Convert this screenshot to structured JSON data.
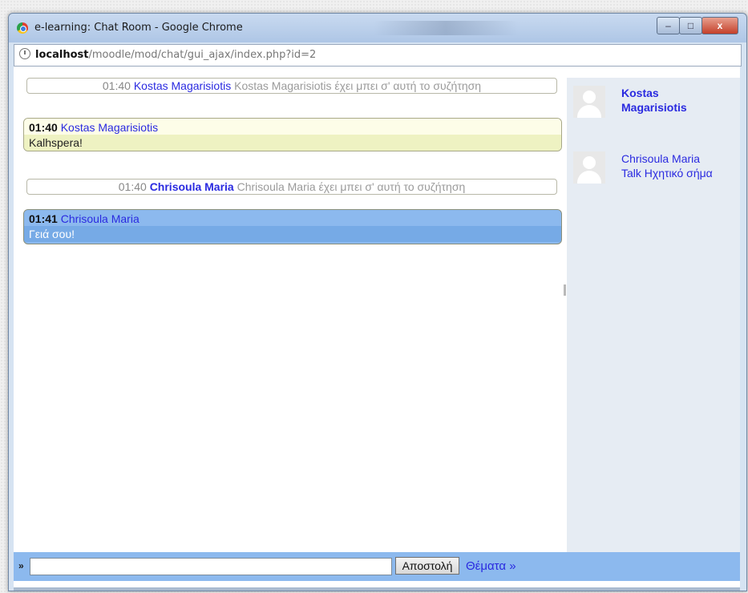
{
  "window": {
    "title": "e-learning: Chat Room - Google Chrome",
    "controls": {
      "minimize": "–",
      "maximize": "□",
      "close": "x"
    }
  },
  "urlbar": {
    "host": "localhost",
    "path": "/moodle/mod/chat/gui_ajax/index.php?id=2"
  },
  "messages": [
    {
      "kind": "system",
      "time": "01:40",
      "user": "Kostas Magarisiotis",
      "text": "Kostas Magarisiotis έχει μπει σ' αυτή το συζήτηση"
    },
    {
      "kind": "chat",
      "time": "01:40",
      "user": "Kostas Magarisiotis",
      "text": "Kalhspera!"
    },
    {
      "kind": "system",
      "time": "01:40",
      "user": "Chrisoula Maria",
      "text": "Chrisoula Maria έχει μπει σ' αυτή το συζήτηση"
    },
    {
      "kind": "chat",
      "time": "01:41",
      "user": "Chrisoula Maria",
      "text": "Γειά σου!"
    }
  ],
  "users": [
    {
      "name": "Kostas Magarisiotis"
    },
    {
      "name": "Chrisoula Maria",
      "talk": "Talk Ηχητικό σήμα"
    }
  ],
  "input_bar": {
    "prefix": "»",
    "input_value": "",
    "send_label": "Αποστολή",
    "themes_label": "Θέματα »"
  },
  "colors": {
    "link_blue": "#2a2ae0",
    "chat_bar_blue": "#8cb9ee",
    "user_panel": "#e6ecf3",
    "own_message_highlight": "#eef2c2"
  }
}
